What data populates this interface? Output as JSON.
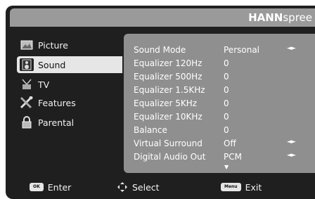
{
  "brand": {
    "bold": "HANN",
    "rest": "spree"
  },
  "sidebar": {
    "items": [
      {
        "label": "Picture",
        "icon": "picture-icon"
      },
      {
        "label": "Sound",
        "icon": "speaker-icon",
        "selected": true
      },
      {
        "label": "TV",
        "icon": "antenna-icon"
      },
      {
        "label": "Features",
        "icon": "tools-icon"
      },
      {
        "label": "Parental",
        "icon": "lock-icon"
      }
    ]
  },
  "settings": [
    {
      "label": "Sound Mode",
      "value": "Personal",
      "arrows": "◄►"
    },
    {
      "label": "Equalizer 120Hz",
      "value": "0",
      "arrows": ""
    },
    {
      "label": "Equalizer 500Hz",
      "value": "0",
      "arrows": ""
    },
    {
      "label": "Equalizer 1.5KHz",
      "value": "0",
      "arrows": ""
    },
    {
      "label": "Equalizer 5KHz",
      "value": "0",
      "arrows": ""
    },
    {
      "label": "Equalizer 10KHz",
      "value": "0",
      "arrows": ""
    },
    {
      "label": "Balance",
      "value": "0",
      "arrows": ""
    },
    {
      "label": "Virtual Surround",
      "value": "Off",
      "arrows": "◄►"
    },
    {
      "label": "Digital Audio Out",
      "value": "PCM",
      "arrows": "◄►"
    }
  ],
  "footer": {
    "ok_key": "OK",
    "enter_label": "Enter",
    "select_label": "Select",
    "menu_key": "Menu",
    "exit_label": "Exit"
  }
}
